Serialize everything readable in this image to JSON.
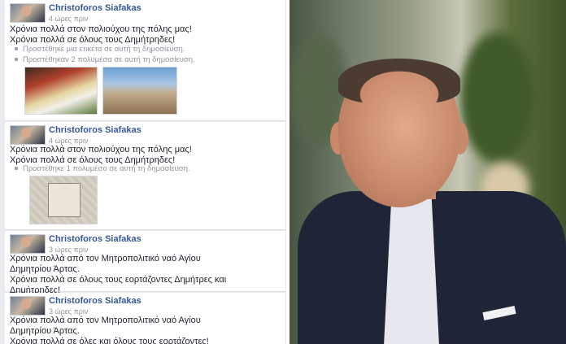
{
  "colors": {
    "name_link": "#365899",
    "secondary_text": "#90949c",
    "feed_bg": "#e9ebee"
  },
  "posts": [
    {
      "author": "Christoforos Siafakas",
      "time": "4 ώρες πριν",
      "lines": [
        "Χρόνια πολλά στον πολιούχου της πόλης μας!",
        "Χρόνια πολλά σε όλους τους Δημήτρηδες!"
      ],
      "meta": [
        "Προστέθηκε μια ετικέτα σε αυτή τη δημοσίευση.",
        "Προστέθηκαν 2 πολυμέσα σε αυτή τη δημοσίευση."
      ],
      "media": [
        "icon-image",
        "church-image"
      ]
    },
    {
      "author": "Christoforos Siafakas",
      "time": "4 ώρες πριν",
      "lines": [
        "Χρόνια πολλά στον πολιούχου της πόλης μας!",
        "Χρόνια πολλά σε όλους τους Δημήτρηδες!"
      ],
      "meta": [
        "Προστέθηκε 1 πολυμέσο σε αυτή τη δημοσίευση."
      ],
      "media": [
        "pillow-image"
      ]
    },
    {
      "author": "Christoforos Siafakas",
      "time": "3 ώρες πριν",
      "lines": [
        "Χρόνια πολλά από τον Μητροπολιτικό ναό Αγίου",
        "Δημητρίου Άρτας.",
        "Χρόνια πολλά σε όλους τους εορτάζοντες Δημήτρες και",
        "Δημήτρηδες!"
      ]
    },
    {
      "author": "Christoforos Siafakas",
      "time": "3 ώρες πριν",
      "lines": [
        "Χρόνια πολλά από τον Μητροπολιτικό ναό Αγίου",
        "Δημητρίου Άρτας.",
        "Χρόνια πολλά σε όλες και όλους τους εορτάζοντες!"
      ]
    }
  ]
}
